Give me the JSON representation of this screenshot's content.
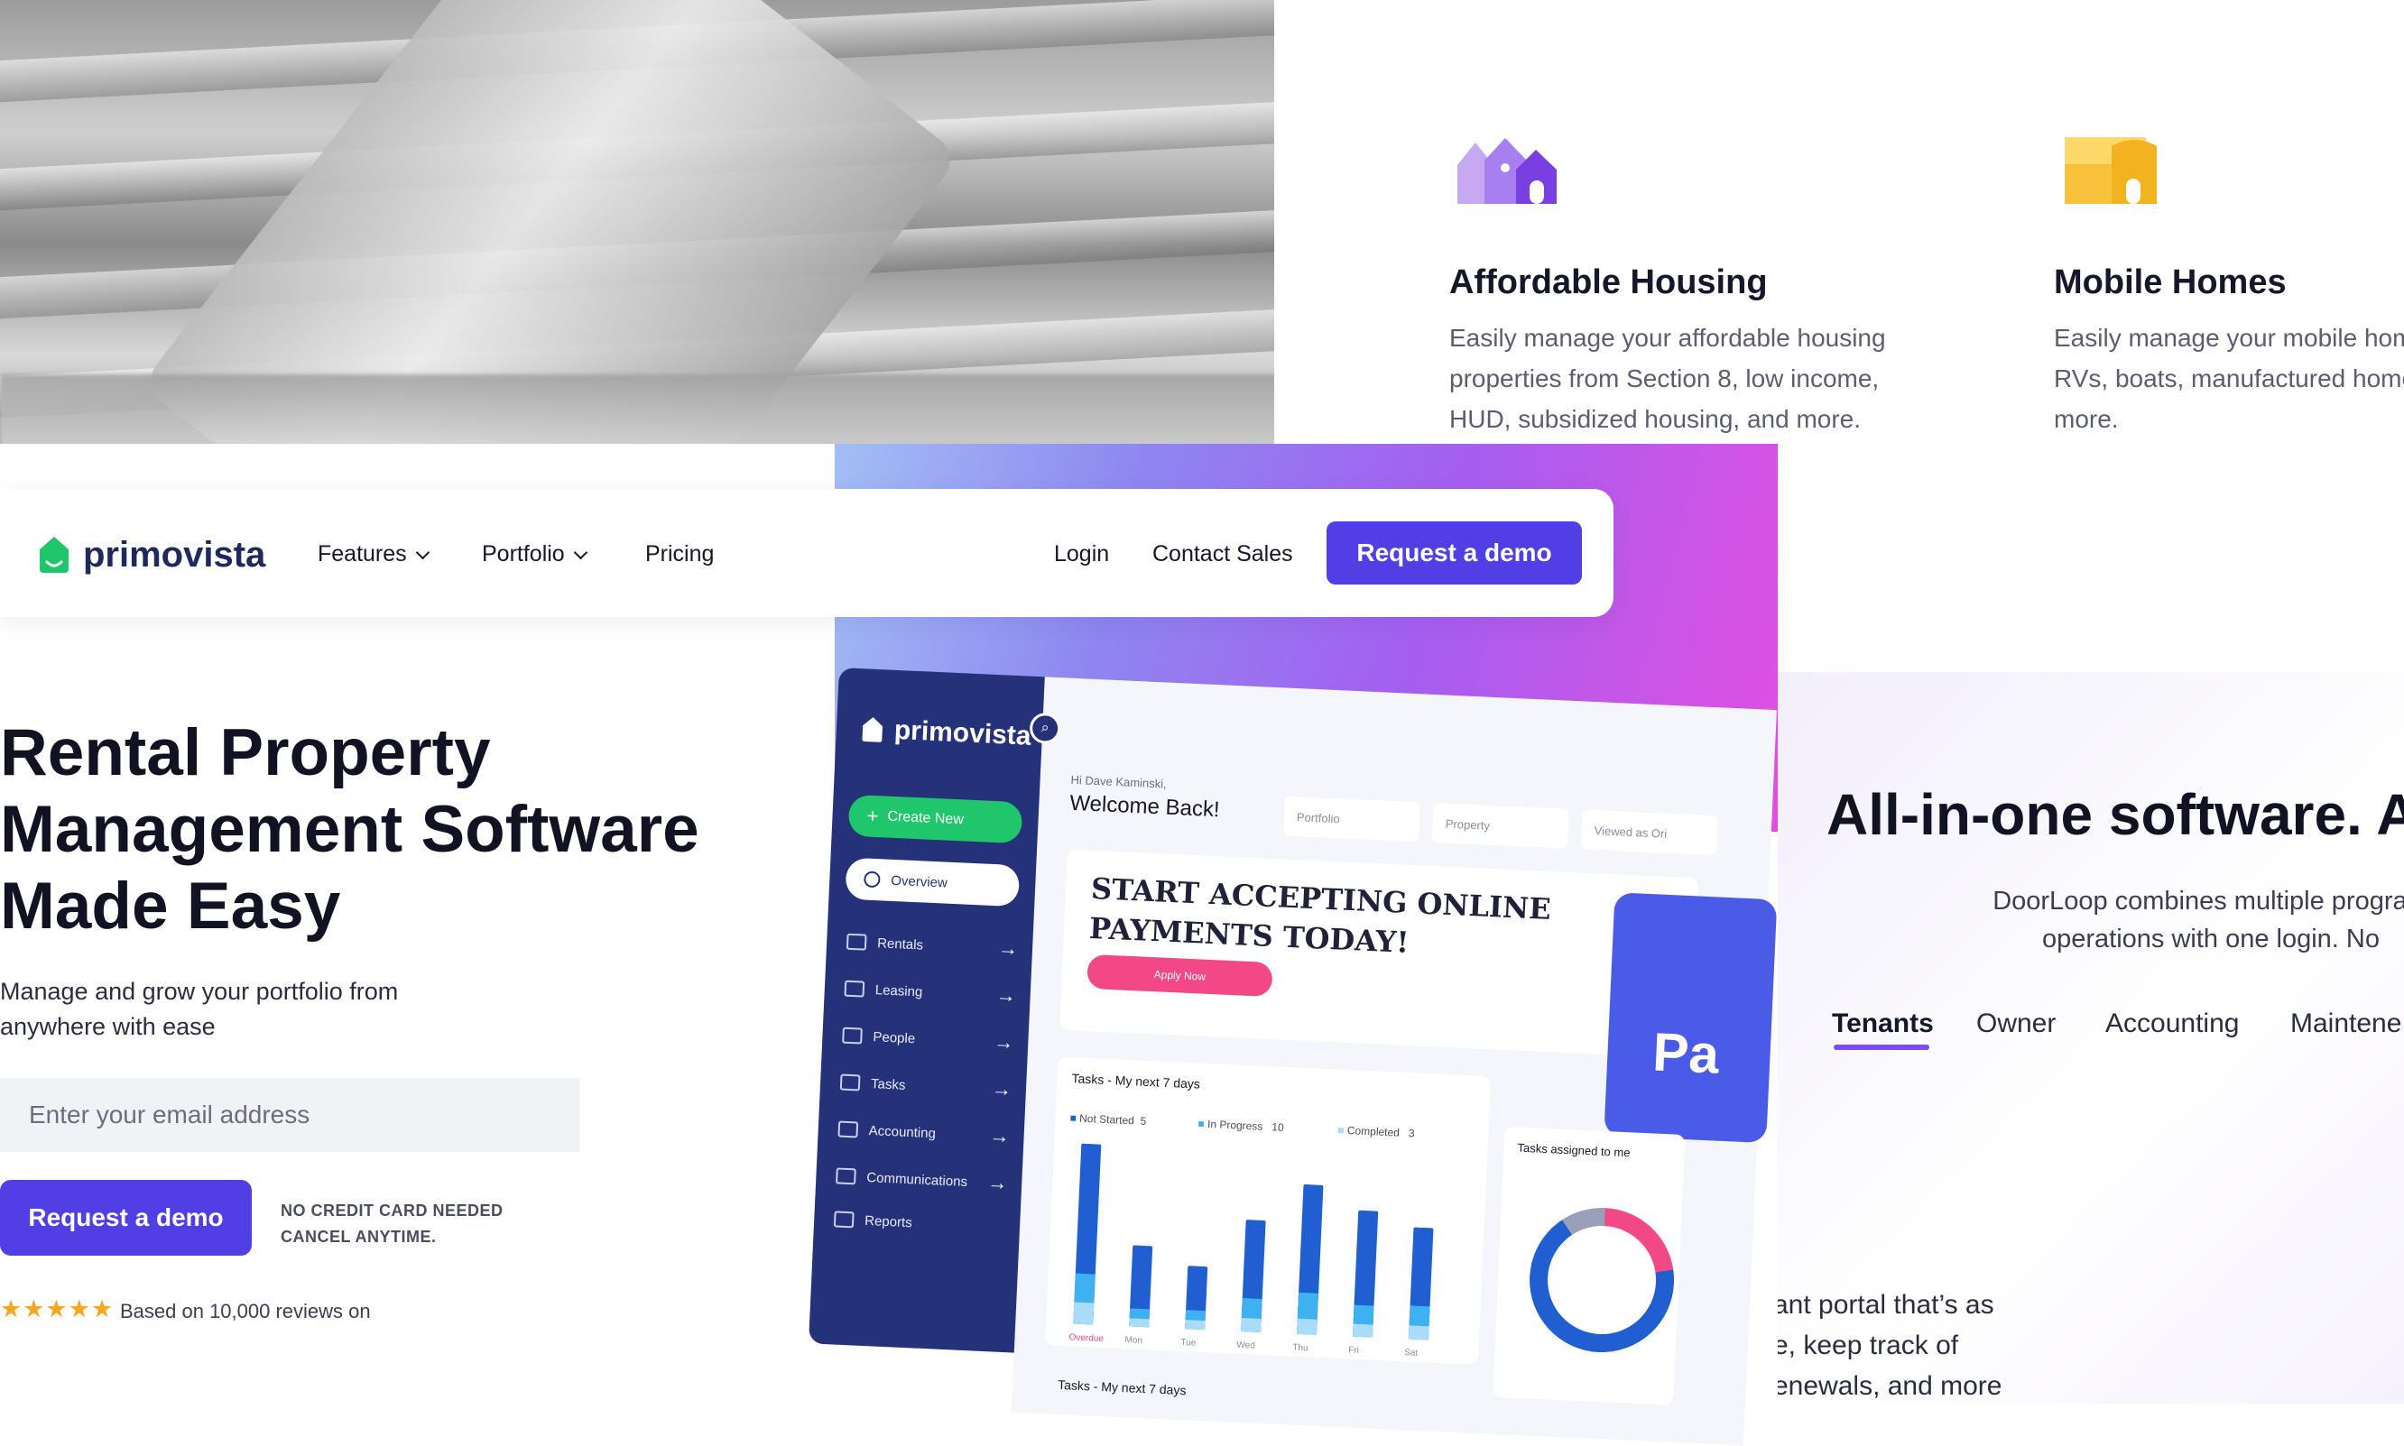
{
  "features": [
    {
      "title": "Affordable Housing",
      "desc": "Easily manage your affordable housing\nproperties from Section 8, low income,\nHUD, subsidized housing, and more.",
      "icon": "affordable-housing-icon"
    },
    {
      "title": "Mobile Homes",
      "desc": "Easily manage your mobile homes,\nRVs, boats, manufactured homes, and\nmore.",
      "icon": "mobile-homes-icon"
    }
  ],
  "nav": {
    "logo": "primovista",
    "items": [
      "Features",
      "Portfolio",
      "Pricing"
    ],
    "login": "Login",
    "contact": "Contact Sales",
    "demo": "Request a demo"
  },
  "hero": {
    "title": "Rental Property\nManagement Software\nMade Easy",
    "subtitle": "Manage and grow your portfolio from\nanywhere with ease",
    "email_placeholder": "Enter your email address",
    "demo": "Request a demo",
    "no_card": "NO CREDIT CARD NEEDED\nCANCEL ANYTIME.",
    "stars": "★★★★★",
    "reviews": "Based on 10,000 reviews on"
  },
  "dashboard": {
    "logo": "primovista",
    "create": "Create New",
    "overview": "Overview",
    "nav": [
      "Rentals",
      "Leasing",
      "People",
      "Tasks",
      "Accounting",
      "Communications",
      "Reports"
    ],
    "greeting": "Hi Dave Kaminski,",
    "welcome": "Welcome Back!",
    "selects": [
      "Portfolio",
      "Property",
      "Viewed as Ori"
    ],
    "banner": "START ACCEPTING ONLINE\nPAYMENTS TODAY!",
    "apply": "Apply Now",
    "phone_text": "Pa",
    "tasks_title": "Tasks - My next 7 days",
    "legend": {
      "not_started": "Not Started",
      "not_started_count": "5",
      "in_progress": "In Progress",
      "in_progress_count": "10",
      "completed": "Completed",
      "completed_count": "3"
    },
    "days": [
      "Overdue",
      "Mon",
      "Tue",
      "Wed",
      "Thu",
      "Fri",
      "Sat"
    ],
    "bars": [
      {
        "total": 1.0,
        "progress": 0.28,
        "completed": 0.12
      },
      {
        "total": 0.45,
        "progress": 0.22,
        "completed": 0.1
      },
      {
        "total": 0.35,
        "progress": 0.3,
        "completed": 0.14
      },
      {
        "total": 0.62,
        "progress": 0.3,
        "completed": 0.12
      },
      {
        "total": 0.83,
        "progress": 0.28,
        "completed": 0.1
      },
      {
        "total": 0.7,
        "progress": 0.25,
        "completed": 0.1
      },
      {
        "total": 0.62,
        "progress": 0.3,
        "completed": 0.12
      }
    ],
    "assigned_title": "Tasks assigned to me",
    "tasks_title_2": "Tasks - My next 7 days",
    "colors": {
      "sidebar": "#253279",
      "create": "#1fc66b",
      "apply": "#f24886",
      "bar": "#1f5fcf"
    }
  },
  "allinone": {
    "title": "All-in-one software. A",
    "desc": "DoorLoop combines multiple program\noperations with one login. No",
    "tabs": [
      "Tenants",
      "Owner",
      "Accounting",
      "Maintene"
    ],
    "active_tab": "Tenants",
    "portal": "ant portal that’s as\ne, keep track of\nenewals, and more"
  },
  "colors": {
    "primary": "#4f3fe4",
    "brand_green": "#1fc66b",
    "tab_accent": "#7c4dff",
    "star": "#f5a623"
  }
}
